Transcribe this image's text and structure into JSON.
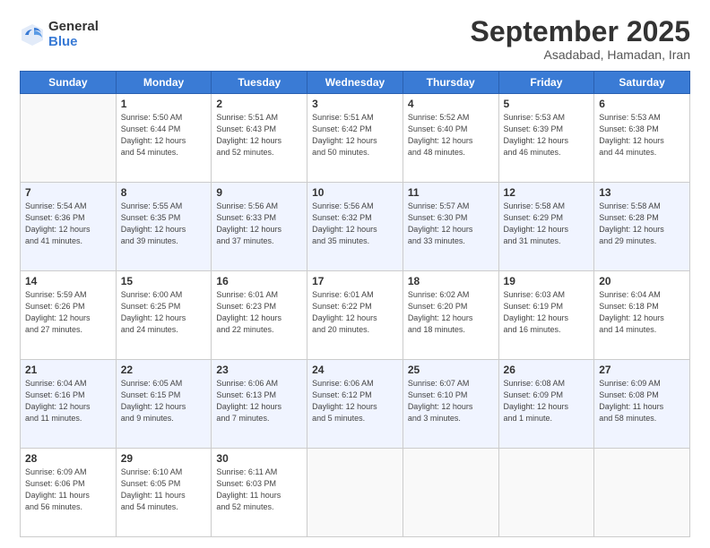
{
  "logo": {
    "general": "General",
    "blue": "Blue"
  },
  "header": {
    "month": "September 2025",
    "location": "Asadabad, Hamadan, Iran"
  },
  "weekdays": [
    "Sunday",
    "Monday",
    "Tuesday",
    "Wednesday",
    "Thursday",
    "Friday",
    "Saturday"
  ],
  "weeks": [
    [
      {
        "day": "",
        "info": ""
      },
      {
        "day": "1",
        "info": "Sunrise: 5:50 AM\nSunset: 6:44 PM\nDaylight: 12 hours\nand 54 minutes."
      },
      {
        "day": "2",
        "info": "Sunrise: 5:51 AM\nSunset: 6:43 PM\nDaylight: 12 hours\nand 52 minutes."
      },
      {
        "day": "3",
        "info": "Sunrise: 5:51 AM\nSunset: 6:42 PM\nDaylight: 12 hours\nand 50 minutes."
      },
      {
        "day": "4",
        "info": "Sunrise: 5:52 AM\nSunset: 6:40 PM\nDaylight: 12 hours\nand 48 minutes."
      },
      {
        "day": "5",
        "info": "Sunrise: 5:53 AM\nSunset: 6:39 PM\nDaylight: 12 hours\nand 46 minutes."
      },
      {
        "day": "6",
        "info": "Sunrise: 5:53 AM\nSunset: 6:38 PM\nDaylight: 12 hours\nand 44 minutes."
      }
    ],
    [
      {
        "day": "7",
        "info": "Sunrise: 5:54 AM\nSunset: 6:36 PM\nDaylight: 12 hours\nand 41 minutes."
      },
      {
        "day": "8",
        "info": "Sunrise: 5:55 AM\nSunset: 6:35 PM\nDaylight: 12 hours\nand 39 minutes."
      },
      {
        "day": "9",
        "info": "Sunrise: 5:56 AM\nSunset: 6:33 PM\nDaylight: 12 hours\nand 37 minutes."
      },
      {
        "day": "10",
        "info": "Sunrise: 5:56 AM\nSunset: 6:32 PM\nDaylight: 12 hours\nand 35 minutes."
      },
      {
        "day": "11",
        "info": "Sunrise: 5:57 AM\nSunset: 6:30 PM\nDaylight: 12 hours\nand 33 minutes."
      },
      {
        "day": "12",
        "info": "Sunrise: 5:58 AM\nSunset: 6:29 PM\nDaylight: 12 hours\nand 31 minutes."
      },
      {
        "day": "13",
        "info": "Sunrise: 5:58 AM\nSunset: 6:28 PM\nDaylight: 12 hours\nand 29 minutes."
      }
    ],
    [
      {
        "day": "14",
        "info": "Sunrise: 5:59 AM\nSunset: 6:26 PM\nDaylight: 12 hours\nand 27 minutes."
      },
      {
        "day": "15",
        "info": "Sunrise: 6:00 AM\nSunset: 6:25 PM\nDaylight: 12 hours\nand 24 minutes."
      },
      {
        "day": "16",
        "info": "Sunrise: 6:01 AM\nSunset: 6:23 PM\nDaylight: 12 hours\nand 22 minutes."
      },
      {
        "day": "17",
        "info": "Sunrise: 6:01 AM\nSunset: 6:22 PM\nDaylight: 12 hours\nand 20 minutes."
      },
      {
        "day": "18",
        "info": "Sunrise: 6:02 AM\nSunset: 6:20 PM\nDaylight: 12 hours\nand 18 minutes."
      },
      {
        "day": "19",
        "info": "Sunrise: 6:03 AM\nSunset: 6:19 PM\nDaylight: 12 hours\nand 16 minutes."
      },
      {
        "day": "20",
        "info": "Sunrise: 6:04 AM\nSunset: 6:18 PM\nDaylight: 12 hours\nand 14 minutes."
      }
    ],
    [
      {
        "day": "21",
        "info": "Sunrise: 6:04 AM\nSunset: 6:16 PM\nDaylight: 12 hours\nand 11 minutes."
      },
      {
        "day": "22",
        "info": "Sunrise: 6:05 AM\nSunset: 6:15 PM\nDaylight: 12 hours\nand 9 minutes."
      },
      {
        "day": "23",
        "info": "Sunrise: 6:06 AM\nSunset: 6:13 PM\nDaylight: 12 hours\nand 7 minutes."
      },
      {
        "day": "24",
        "info": "Sunrise: 6:06 AM\nSunset: 6:12 PM\nDaylight: 12 hours\nand 5 minutes."
      },
      {
        "day": "25",
        "info": "Sunrise: 6:07 AM\nSunset: 6:10 PM\nDaylight: 12 hours\nand 3 minutes."
      },
      {
        "day": "26",
        "info": "Sunrise: 6:08 AM\nSunset: 6:09 PM\nDaylight: 12 hours\nand 1 minute."
      },
      {
        "day": "27",
        "info": "Sunrise: 6:09 AM\nSunset: 6:08 PM\nDaylight: 11 hours\nand 58 minutes."
      }
    ],
    [
      {
        "day": "28",
        "info": "Sunrise: 6:09 AM\nSunset: 6:06 PM\nDaylight: 11 hours\nand 56 minutes."
      },
      {
        "day": "29",
        "info": "Sunrise: 6:10 AM\nSunset: 6:05 PM\nDaylight: 11 hours\nand 54 minutes."
      },
      {
        "day": "30",
        "info": "Sunrise: 6:11 AM\nSunset: 6:03 PM\nDaylight: 11 hours\nand 52 minutes."
      },
      {
        "day": "",
        "info": ""
      },
      {
        "day": "",
        "info": ""
      },
      {
        "day": "",
        "info": ""
      },
      {
        "day": "",
        "info": ""
      }
    ]
  ]
}
